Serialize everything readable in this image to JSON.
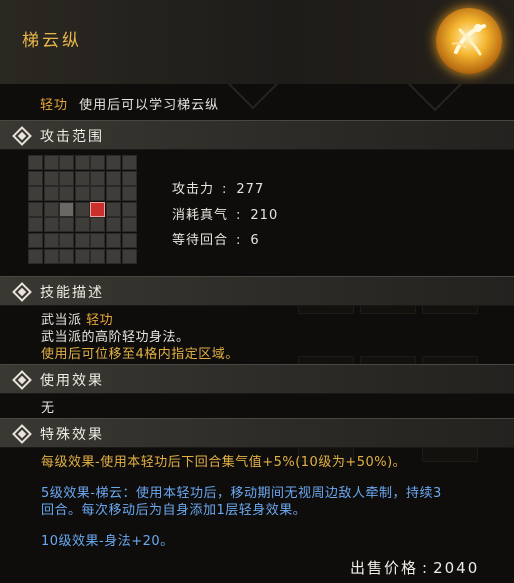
{
  "title": "梯云纵",
  "description": {
    "tag": "轻功",
    "text": "使用后可以学习梯云纵"
  },
  "sections": {
    "range": "攻击范围",
    "skill_desc": "技能描述",
    "use_effect": "使用效果",
    "special_effect": "特殊效果"
  },
  "stats": [
    {
      "label": "攻击力",
      "value": "277"
    },
    {
      "label": "消耗真气",
      "value": "210"
    },
    {
      "label": "等待回合",
      "value": "6"
    }
  ],
  "skill_desc": {
    "school": "武当派",
    "type": "轻功",
    "line2": "武当派的高阶轻功身法。",
    "line3": "使用后可位移至4格内指定区域。"
  },
  "use_effect_text": "无",
  "special": {
    "line1": "每级效果-使用本轻功后下回合集气值+5%(10级为+50%)。",
    "line2": "5级效果-梯云：使用本轻功后，移动期间无视周边敌人牵制，持续3",
    "line3": "回合。每次移动后为自身添加1层轻身效果。",
    "line4": "10级效果-身法+20。"
  },
  "price": {
    "label": "出售价格",
    "value": "2040"
  },
  "colors": {
    "gold": "#e8a838",
    "blue": "#6aa8f0",
    "target": "#c9302c"
  }
}
